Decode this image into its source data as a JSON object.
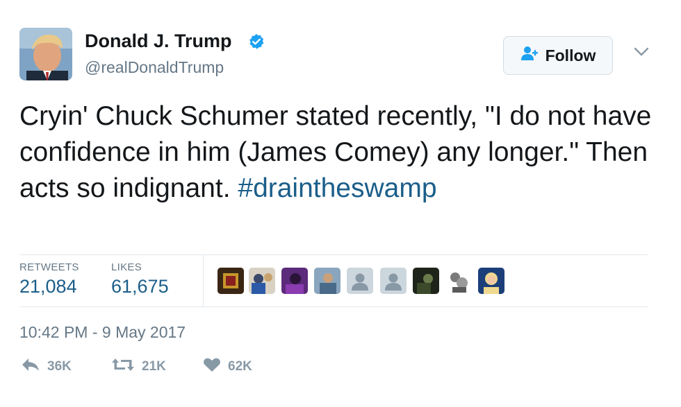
{
  "author": {
    "name": "Donald J. Trump",
    "handle": "@realDonaldTrump",
    "verified": true
  },
  "follow_button": {
    "label": "Follow",
    "icon": "follow-person-icon"
  },
  "menu": {
    "icon": "chevron-down-icon"
  },
  "tweet": {
    "text": "Cryin' Chuck Schumer stated recently, \"I do not have confidence in him (James Comey) any longer.\" Then acts so indignant. ",
    "hashtag": "#draintheswamp"
  },
  "stats": {
    "retweets_label": "RETWEETS",
    "retweets_value": "21,084",
    "likes_label": "LIKES",
    "likes_value": "61,675"
  },
  "timestamp": "10:42 PM - 9 May 2017",
  "actions": {
    "reply_count": "36K",
    "retweet_count": "21K",
    "like_count": "62K"
  },
  "colors": {
    "link": "#1b5e8a",
    "verified": "#1da1f2",
    "muted": "#657786",
    "action": "#8899a6"
  }
}
